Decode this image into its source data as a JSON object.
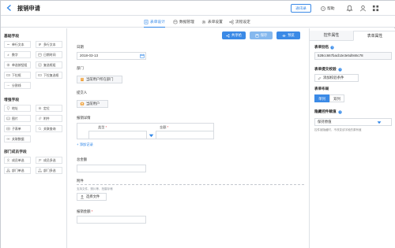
{
  "header": {
    "title": "报销申请",
    "contacts_label": "通讯录",
    "help_label": "帮助"
  },
  "tabs": [
    {
      "label": "表单设计",
      "icon": "form-icon",
      "active": true
    },
    {
      "label": "数据管理",
      "icon": "database-icon",
      "active": false
    },
    {
      "label": "表单设置",
      "icon": "gear-icon",
      "active": false
    },
    {
      "label": "流程设定",
      "icon": "flow-icon",
      "active": false
    }
  ],
  "left_panel": {
    "sections": [
      {
        "title": "基础字段",
        "items": [
          "单行文本",
          "多行文本",
          "数字",
          "日期时间",
          "单选按钮组",
          "复选框组",
          "下拉框",
          "下拉复选框",
          "分割线"
        ]
      },
      {
        "title": "增强字段",
        "items": [
          "地址",
          "定位",
          "图片",
          "附件",
          "子表单",
          "关联查询",
          "关联数据"
        ]
      },
      {
        "title": "部门成员字段",
        "items": [
          "成员单选",
          "成员多选",
          "部门单选",
          "部门多选"
        ]
      }
    ]
  },
  "toolbar": {
    "share_label": "共享给",
    "save_label": "保存",
    "preview_label": "预览"
  },
  "form": {
    "date_label": "日期",
    "date_value": "2018-03-13",
    "dept_label": "部门",
    "dept_chip": "当前用户所在部门",
    "applicant_label": "提交人",
    "applicant_chip": "当前用户",
    "details_label": "报销详情",
    "col_type": "类型",
    "col_amount": "金额",
    "add_record": "+ 添加记录",
    "total_label": "总金额",
    "attachment_label": "附件",
    "attachment_hint": "支持文件、照片等，拍摄存储",
    "choose_file": "选择文件",
    "amount_label": "报销金额"
  },
  "right_panel": {
    "tab_field": "控件属性",
    "tab_form": "表单属性",
    "alias_label": "表单别名",
    "alias_value": "528cc667bacb2e3e5d946c78",
    "submit_check_label": "表单提交校验",
    "add_check": "添加校验条件",
    "layout_label": "表单布局",
    "layout_single": "单列",
    "layout_double": "双列",
    "hidden_label": "隐藏控件赋值",
    "hidden_value": "保持原值",
    "hidden_hint": "控件被隐藏时，不改变该字段的原有值"
  },
  "colors": {
    "accent": "#2f86e8",
    "button_bg": "#3b8ae6",
    "border": "#dde1e6",
    "required": "#e4393c"
  }
}
